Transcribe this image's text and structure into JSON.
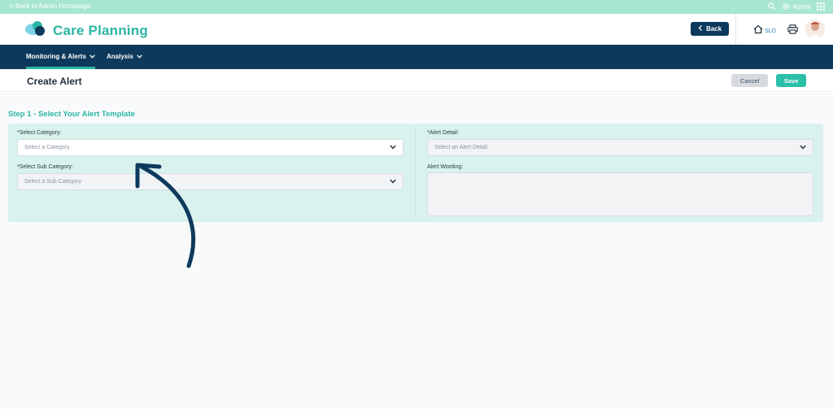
{
  "topbar": {
    "back_link": "< Back to Admin Homepage",
    "admin_label": "Admin"
  },
  "header": {
    "title": "Care Planning",
    "back_button": "Back",
    "location": "SLO"
  },
  "nav": {
    "items": [
      {
        "label": "Monitoring & Alerts"
      },
      {
        "label": "Analysis"
      }
    ]
  },
  "page": {
    "title": "Create Alert",
    "cancel_label": "Cancel",
    "save_label": "Save"
  },
  "step": {
    "title": "Step 1 - Select Your Alert Template",
    "category": {
      "label": "*Select Category:",
      "placeholder": "Select a Category"
    },
    "sub_category": {
      "label": "*Select Sub Category:",
      "placeholder": "Select a Sub Category"
    },
    "alert_detail": {
      "label": "*Alert Detail:",
      "placeholder": "Select an Alert Detail"
    },
    "alert_wording": {
      "label": "Alert Wording:"
    }
  },
  "colors": {
    "accent": "#2bb5a5",
    "navy": "#0d3a5c",
    "topbar": "#a7e6d2",
    "panel": "#d9f2ee"
  },
  "icons": [
    "search-icon",
    "gear-icon",
    "grid-icon",
    "logo-icon",
    "chevron-left-icon",
    "home-icon",
    "printer-icon",
    "chevron-down-icon",
    "annotation-arrow"
  ]
}
